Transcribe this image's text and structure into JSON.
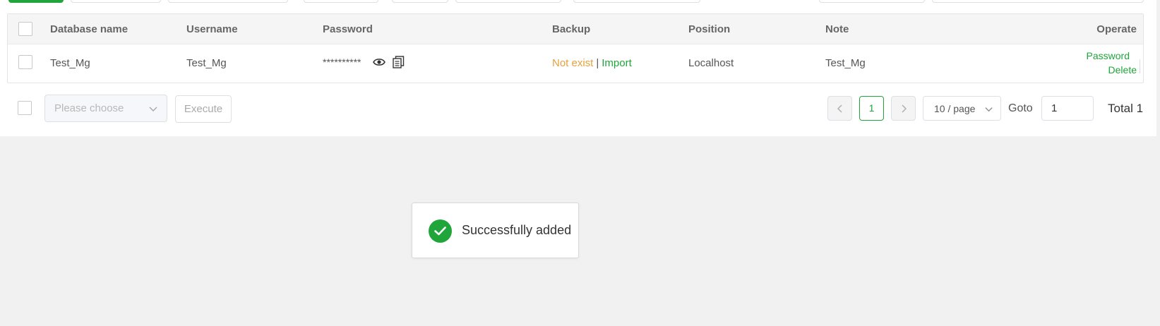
{
  "table": {
    "columns": [
      "Database name",
      "Username",
      "Password",
      "Backup",
      "Position",
      "Note",
      "Operate"
    ],
    "rows": [
      {
        "database_name": "Test_Mg",
        "username": "Test_Mg",
        "password_mask": "**********",
        "backup_status": "Not exist",
        "backup_separator": "|",
        "backup_action": "Import",
        "position": "Localhost",
        "note": "Test_Mg",
        "op_password": "Password",
        "op_delete": "Delete"
      }
    ]
  },
  "batch": {
    "select_placeholder": "Please choose",
    "execute_label": "Execute"
  },
  "pagination": {
    "current_page": "1",
    "per_page": "10 / page",
    "goto_label": "Goto",
    "goto_value": "1",
    "total": "Total 1"
  },
  "toast": {
    "message": "Successfully added"
  },
  "colors": {
    "primary": "#20a53a",
    "warning": "#e6a23c"
  }
}
